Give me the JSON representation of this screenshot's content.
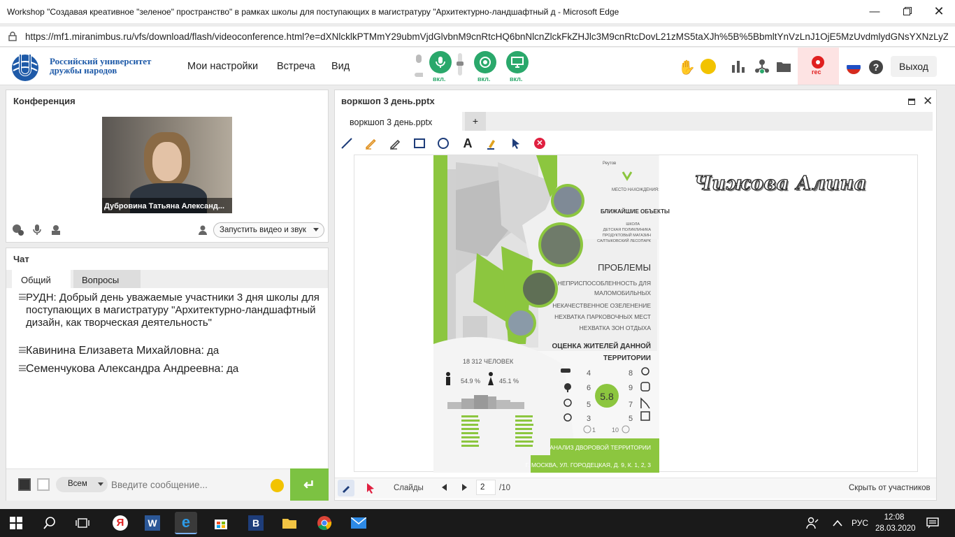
{
  "window": {
    "title": "Workshop \"Создавая креативное \"зеленое\" пространство\" в рамках школы для поступающих в магистратуру \"Архитектурно-ландшафтный д - Microsoft Edge",
    "url": "https://mf1.miranimbus.ru/vfs/download/flash/videoconference.html?e=dXNlcklkPTMmY29ubmVjdGlvbnM9cnRtcHQ6bnNlcnZlckFkZHJlc3M9cnRtcDovL21zMS5taXJh%5B%5BbmltYnVzLnJ1OjE5MzUvdmlydGNsYXNzLyZzZXNzaW9uS",
    "url_host": "mf1.miranimbus.ru"
  },
  "header": {
    "logo_line1": "Российский университет",
    "logo_line2": "дружбы народов",
    "menu": [
      "Мои настройки",
      "Встреча",
      "Вид"
    ],
    "mic_label": "вкл.",
    "cam_label": "вкл.",
    "screen_label": "вкл.",
    "rec_label": "rec",
    "exit_label": "Выход"
  },
  "conference": {
    "title": "Конференция",
    "participant_name": "Дубровина Татьяна Александ...",
    "start_button": "Запустить видео и звук"
  },
  "chat": {
    "title": "Чат",
    "tabs": [
      "Общий",
      "Вопросы"
    ],
    "messages": [
      {
        "author": "РУДН:",
        "text": "Добрый день уважаемые участники 3 дня школы для поступающих в магистратуру \"Архитектурно-ландшафтный дизайн, как творческая деятельность\""
      },
      {
        "author": "Кавинина  Елизавета  Михайловна:",
        "text": "да"
      },
      {
        "author": "Семенчукова Александра  Андреевна:",
        "text": "да"
      }
    ],
    "recipient": "Всем",
    "input_placeholder": "Введите сообщение..."
  },
  "presentation": {
    "title": "воркшоп 3 день.pptx",
    "tab_label": "воркшоп 3 день.pptx",
    "add_tab": "+",
    "slides_label": "Слайды",
    "current_slide": "2",
    "total_slides": "/10",
    "hide_label": "Скрыть от участников"
  },
  "slide": {
    "author": "Чижова Алина",
    "map_label_top": "Реутов",
    "location_label": "МЕСТО НАХОЖДЕНИЯ:",
    "nearby_title": "БЛИЖАЙШИЕ ОБЪЕКТЫ",
    "nearby_items": [
      "ШКОЛА",
      "ДЕТСКАЯ ПОЛИКЛИНИКА",
      "ПРОДУКТОВЫЙ МАГАЗИН",
      "САЛТЫКОВСКИЙ ЛЕСОПАРК"
    ],
    "problems_title": "ПРОБЛЕМЫ",
    "problems": [
      "НЕПРИСПОСОБЛЕННОСТЬ ДЛЯ",
      "МАЛОМОБИЛЬНЫХ",
      "НЕКАЧЕСТВЕННОЕ ОЗЕЛЕНЕНИЕ",
      "НЕХВАТКА ПАРКОВОЧНЫХ МЕСТ",
      "НЕХВАТКА ЗОН ОТДЫХА"
    ],
    "rating_title_1": "ОЦЕНКА ЖИТЕЛЕЙ ДАННОЙ",
    "rating_title_2": "ТЕРРИТОРИИ",
    "population": "18 312 ЧЕЛОВЕК",
    "male_pct": "54.9 %",
    "female_pct": "45.1 %",
    "ratings_left": [
      "4",
      "6",
      "5",
      "3"
    ],
    "ratings_right": [
      "8",
      "9",
      "7",
      "5"
    ],
    "score": "5.8",
    "scale_min": "1",
    "scale_max": "10",
    "footer_1": "АНАЛИЗ ДВОРОВОЙ ТЕРРИТОРИИ",
    "footer_2": "Г. МОСКВА, УЛ. ГОРОДЕЦКАЯ, Д. 9, К. 1, 2, 3",
    "accent": "#8cc63f"
  },
  "taskbar": {
    "lang": "РУС",
    "time": "12:08",
    "date": "28.03.2020"
  }
}
